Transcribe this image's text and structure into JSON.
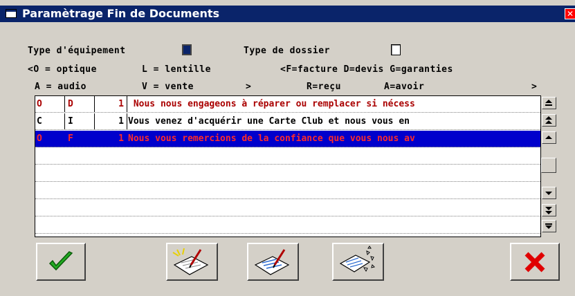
{
  "window": {
    "title": "Paramètrage Fin de Documents",
    "close_glyph": "✕"
  },
  "filters": {
    "equipment_label": "Type d'équipement",
    "equipment_checked": true,
    "dossier_label": "Type de dossier",
    "dossier_checked": false
  },
  "legend": {
    "equip_line1_a": "<O = optique",
    "equip_line1_b": "L = lentille",
    "equip_line2_a": "A = audio",
    "equip_line2_b": "V = vente",
    "equip_close": ">",
    "doc_line1": "<F=facture D=devis G=garanties",
    "doc_line2_a": "R=reçu",
    "doc_line2_b": "A=avoir",
    "doc_close": ">"
  },
  "table": {
    "rows": [
      {
        "equip": "O",
        "type": "D",
        "num": "1",
        "text": " Nous nous engageons à réparer ou remplacer si nécess",
        "style": "red"
      },
      {
        "equip": "C",
        "type": "I",
        "num": "1",
        "text": "Vous venez d'acquérir une Carte Club et nous vous en",
        "style": "normal"
      },
      {
        "equip": "O",
        "type": "F",
        "num": "1",
        "text": "Nous vous remercions de la confiance que vous nous av",
        "style": "selected"
      },
      {
        "equip": "",
        "type": "",
        "num": "",
        "text": "",
        "style": "empty"
      },
      {
        "equip": "",
        "type": "",
        "num": "",
        "text": "",
        "style": "empty"
      },
      {
        "equip": "",
        "type": "",
        "num": "",
        "text": "",
        "style": "empty"
      },
      {
        "equip": "",
        "type": "",
        "num": "",
        "text": "",
        "style": "empty"
      },
      {
        "equip": "",
        "type": "",
        "num": "",
        "text": "",
        "style": "empty"
      }
    ]
  },
  "scroll": {
    "top_icon": "scroll-top-icon",
    "pageup_icon": "page-up-icon",
    "up_icon": "scroll-up-icon",
    "down_icon": "scroll-down-icon",
    "pagedown_icon": "page-down-icon",
    "bottom_icon": "scroll-bottom-icon"
  },
  "buttons": {
    "ok_icon": "checkmark-icon",
    "new_icon": "new-document-icon",
    "edit_icon": "edit-document-icon",
    "delete_icon": "delete-document-icon",
    "cancel_icon": "cancel-x-icon"
  },
  "colors": {
    "selection": "#0000cc",
    "red_text": "#aa0000",
    "title_bar": "#0a246a"
  }
}
